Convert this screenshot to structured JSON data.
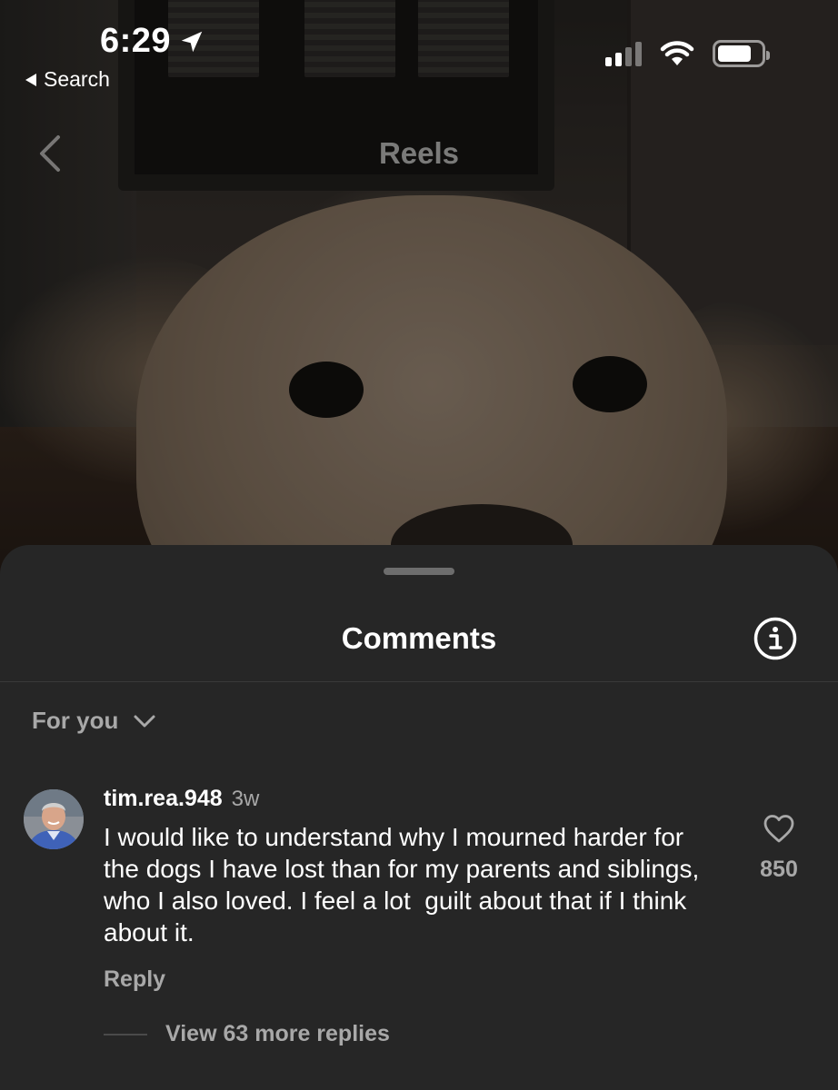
{
  "status_bar": {
    "time": "6:29",
    "back_label": "Search"
  },
  "reels": {
    "title": "Reels"
  },
  "comments_sheet": {
    "title": "Comments",
    "sort_label": "For you",
    "comments": [
      {
        "username": "tim.rea.948",
        "time_ago": "3w",
        "text": "I would like to understand why I mourned harder for the dogs I have lost than for my parents and siblings, who I also loved. I feel a lot  guilt about that if I think about it.",
        "reply_label": "Reply",
        "like_count": "850",
        "view_replies_label": "View 63 more replies"
      }
    ]
  },
  "icons": {
    "location": "location-arrow-icon",
    "signal": "cellular-signal-icon",
    "wifi": "wifi-icon",
    "battery": "battery-icon",
    "back": "chevron-left-icon",
    "info": "info-icon",
    "sort": "chevron-down-icon",
    "like": "heart-outline-icon"
  },
  "colors": {
    "sheet_background": "#262626",
    "secondary_text": "#a8a8a8",
    "primary_text": "#ffffff"
  }
}
